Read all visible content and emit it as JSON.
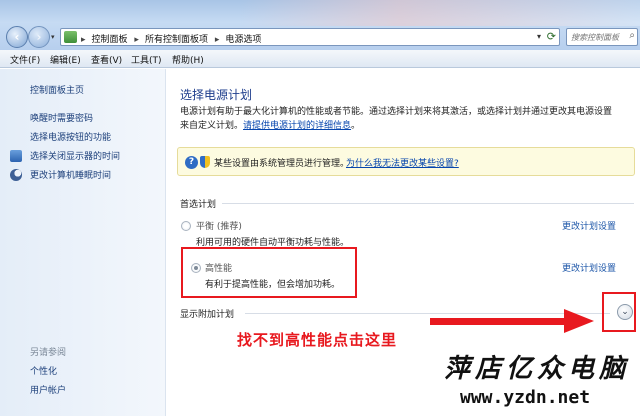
{
  "address_bar": {
    "crumbs": [
      "控制面板",
      "所有控制面板项",
      "电源选项"
    ],
    "search_placeholder": "搜索控制面板"
  },
  "menu": {
    "items": [
      "文件(F)",
      "编辑(E)",
      "查看(V)",
      "工具(T)",
      "帮助(H)"
    ]
  },
  "sidebar": {
    "home": "控制面板主页",
    "links": [
      "唤醒时需要密码",
      "选择电源按钮的功能",
      "选择关闭显示器的时间",
      "更改计算机睡眠时间"
    ],
    "see_also": "另请参阅",
    "see_also_links": [
      "个性化",
      "用户帐户"
    ]
  },
  "main": {
    "title": "选择电源计划",
    "desc_line1": "电源计划有助于最大化计算机的性能或者节能。通过选择计划来将其激活，或选择计划并通过更改其电源设置",
    "desc_line2_prefix": "来自定义计划。",
    "desc_link": "请提供电源计划的详细信息",
    "desc_suffix": "。",
    "info_text": "某些设置由系统管理员进行管理。",
    "info_link": "为什么我无法更改某些设置?",
    "preferred_label": "首选计划",
    "plans": [
      {
        "name": "平衡 (推荐)",
        "desc": "利用可用的硬件自动平衡功耗与性能。",
        "link": "更改计划设置",
        "selected": false
      },
      {
        "name": "高性能",
        "desc": "有利于提高性能，但会增加功耗。",
        "link": "更改计划设置",
        "selected": true
      }
    ],
    "show_more": "显示附加计划",
    "expand_glyph": "⌄"
  },
  "annotation": {
    "text": "找不到高性能点击这里",
    "color": "#e8191f"
  },
  "watermark": {
    "brand": "萍店亿众电脑",
    "url": "www.yzdn.net"
  }
}
